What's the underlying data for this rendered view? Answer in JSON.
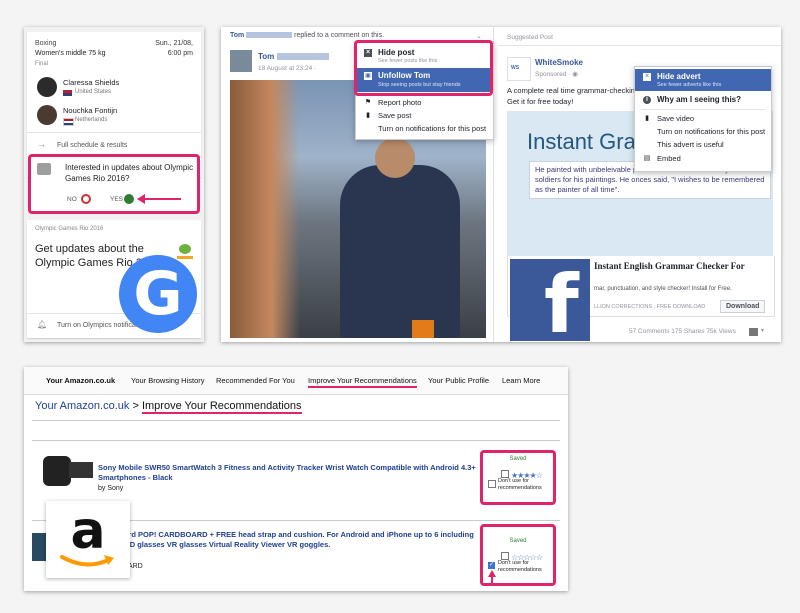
{
  "google": {
    "sport": "Boxing",
    "event": "Women's middle 75 kg",
    "stage": "Final",
    "date": "Sun., 21/08,",
    "time": "6:00 pm",
    "athletes": [
      {
        "name": "Claressa Shields",
        "country": "United States"
      },
      {
        "name": "Nouchka Fontijn",
        "country": "Netherlands"
      }
    ],
    "schedule_link": "Full schedule & results",
    "prompt": "Interested in updates about Olympic Games Rio 2016?",
    "no_label": "NO",
    "yes_label": "YES",
    "card2_header": "Olympic Games Rio 2016",
    "card2_title": "Get updates about the Olympic Games Rio 2016",
    "notif_text": "Turn on Olympics notifications",
    "logo_letter": "G",
    "colors": {
      "accent": "#e0246b",
      "google_blue": "#4285f4"
    }
  },
  "facebook": {
    "notif_name": "Tom",
    "notif_text": "replied to a comment on this.",
    "post_author": "Tom",
    "post_meta": "18 August at 23:24 ·",
    "post_menu": [
      {
        "icon": "x-icon",
        "label": "Hide post",
        "sub": "See fewer posts like this"
      },
      {
        "icon": "unfollow-icon",
        "label": "Unfollow Tom",
        "sub": "Stop seeing posts but stay friends"
      },
      {
        "icon": "report-icon",
        "label": "Report photo"
      },
      {
        "icon": "bookmark-icon",
        "label": "Save post"
      },
      {
        "icon": "",
        "label": "Turn on notifications for this post"
      }
    ],
    "suggested_label": "Suggested Post",
    "ad_name": "WhiteSmoke",
    "ad_meta": "Sponsored · ",
    "ad_text": [
      "A complete real time grammar-checking",
      "Get it for free today!"
    ],
    "ad_image_title": "Instant Gramm",
    "ad_image_text": "He painted with unbeleivable precision He used to actually hire real soldiers for his paintings. He onces said, \"I wishes to be remembered as the painter of all time\".",
    "ad_link_title": "Instant English Grammar Checker For",
    "ad_link_desc": "mar, punctuation, and style checker! Install for Free.",
    "ad_link_domain": "LLION CORRECTIONS , FREE DOWNLOAD",
    "download_label": "Download",
    "ad_stats": "57 Comments  175 Shares  75k Views",
    "ad_menu": [
      {
        "icon": "x-icon",
        "label": "Hide advert",
        "sub": "See fewer adverts like this"
      },
      {
        "icon": "info-icon",
        "label": "Why am I seeing this?"
      },
      {
        "icon": "bookmark-icon",
        "label": "Save video"
      },
      {
        "icon": "",
        "label": "Turn on notifications for this post"
      },
      {
        "icon": "",
        "label": "This advert is useful"
      },
      {
        "icon": "embed-icon",
        "label": "Embed"
      }
    ],
    "logo_letter": "f",
    "colors": {
      "fb_blue": "#3b5998",
      "highlight": "#4267b2"
    }
  },
  "amazon": {
    "nav": [
      "Your Amazon.co.uk",
      "Your Browsing History",
      "Recommended For You",
      "Improve Your Recommendations",
      "Your Public Profile",
      "Learn More"
    ],
    "breadcrumb_root": "Your Amazon.co.uk",
    "breadcrumb_sep": ">",
    "breadcrumb_current": "Improve Your Recommendations",
    "products": [
      {
        "title": "Sony Mobile SWR50 SmartWatch 3 Fitness and Activity Tracker Wrist Watch Compatible with Android 4.3+ Smartphones - Black",
        "by": "by Sony",
        "saved": "Saved",
        "dont_use": "Don't use for recommendations",
        "checked": false,
        "rating": "★★★★☆"
      },
      {
        "title": "Cardboard POP! CARDBOARD + FREE head strap and cushion. For Android and iPhone up to 6 including lenses. 3D glasses VR glasses Virtual Reality Viewer VR goggles.",
        "by": "CARDBOARD",
        "saved": "Saved",
        "dont_use": "Don't use for recommendations",
        "checked": true,
        "rating": "☆☆☆☆☆"
      }
    ],
    "logo_text": "a"
  }
}
